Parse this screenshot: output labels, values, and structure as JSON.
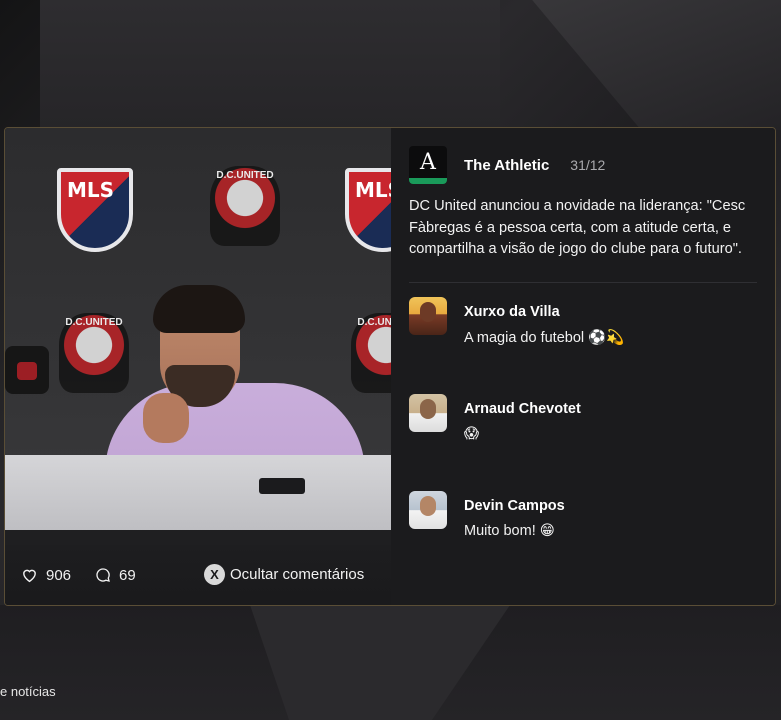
{
  "post": {
    "source": "The Athletic",
    "logo_letter": "A",
    "date": "31/12",
    "text": "DC United anunciou a novidade na liderança: \"Cesc Fàbregas é a pessoa certa, com a atitude certa, e compartilha a visão de jogo do clube para o futuro\".",
    "likes": "906",
    "comments_count": "69",
    "hide_comments_label": "Ocultar comentários",
    "hide_button_glyph": "X"
  },
  "photo": {
    "banner_texts": [
      "MLS",
      "D.C.UNITED"
    ]
  },
  "comments": [
    {
      "name": "Xurxo da Villa",
      "text": "A magia do futebol ⚽💫"
    },
    {
      "name": "Arnaud Chevotet",
      "text": "😱"
    },
    {
      "name": "Devin Campos",
      "text": "Muito bom! 😁"
    }
  ],
  "footer": {
    "label": "e notícias"
  },
  "icons": {
    "like": "heart-icon",
    "comment": "comment-bubble-icon",
    "hide": "x-button-icon"
  },
  "colors": {
    "accent_green": "#1a9a5a",
    "card_border": "#5a4e36",
    "panel_bg": "#1b1b1d"
  }
}
